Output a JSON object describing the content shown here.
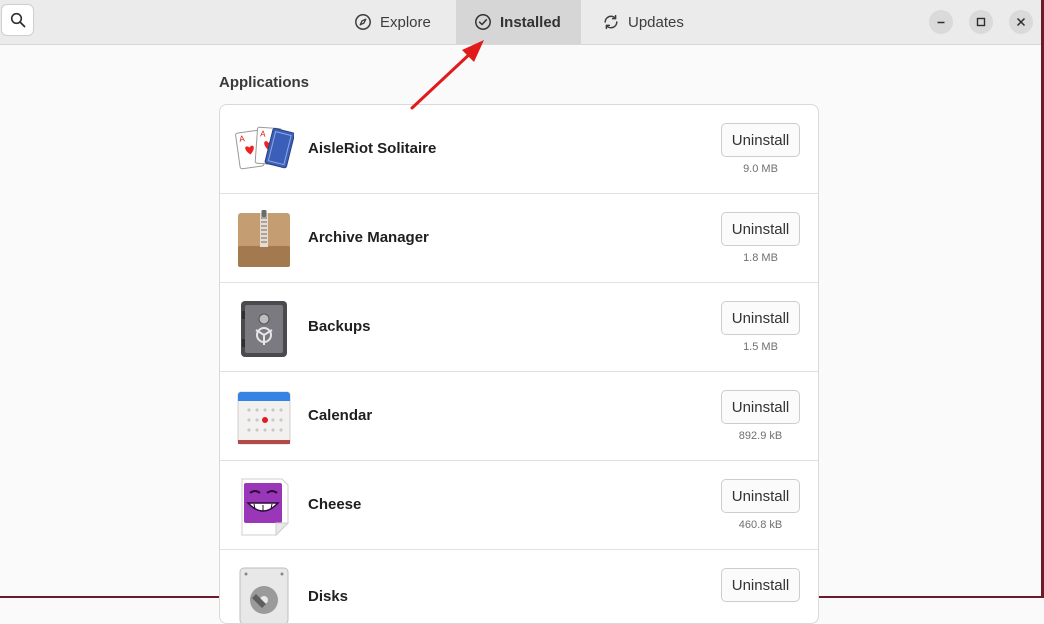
{
  "header": {
    "tabs": [
      {
        "label": "Explore",
        "icon": "compass-icon"
      },
      {
        "label": "Installed",
        "icon": "check-circle-icon",
        "active": true
      },
      {
        "label": "Updates",
        "icon": "refresh-icon"
      }
    ],
    "window_controls": [
      "minimize-icon",
      "maximize-icon",
      "close-icon"
    ]
  },
  "section": {
    "title": "Applications"
  },
  "apps": [
    {
      "name": "AisleRiot Solitaire",
      "size": "9.0 MB",
      "button": "Uninstall",
      "icon": "cards-icon"
    },
    {
      "name": "Archive Manager",
      "size": "1.8 MB",
      "button": "Uninstall",
      "icon": "archive-box-icon"
    },
    {
      "name": "Backups",
      "size": "1.5 MB",
      "button": "Uninstall",
      "icon": "safe-icon"
    },
    {
      "name": "Calendar",
      "size": "892.9 kB",
      "button": "Uninstall",
      "icon": "calendar-icon"
    },
    {
      "name": "Cheese",
      "size": "460.8 kB",
      "button": "Uninstall",
      "icon": "cheese-webcam-icon"
    },
    {
      "name": "Disks",
      "size": "",
      "button": "Uninstall",
      "icon": "disks-icon"
    }
  ],
  "colors": {
    "accent_arrow": "#e01b1b",
    "window_border": "#6d1b2a"
  }
}
